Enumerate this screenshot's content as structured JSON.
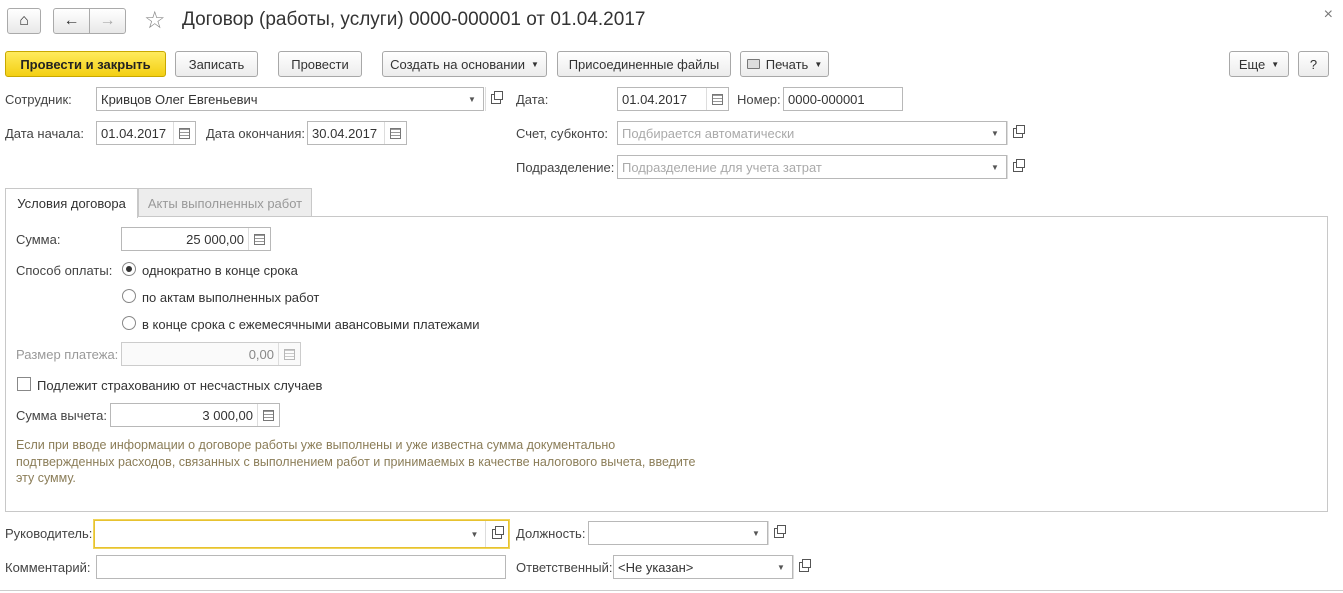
{
  "window": {
    "title": "Договор (работы, услуги) 0000-000001 от 01.04.2017",
    "close_glyph": "×"
  },
  "nav": {
    "home_glyph": "⌂",
    "back_glyph": "←",
    "forward_glyph": "→",
    "favorite_glyph": "☆"
  },
  "toolbar": {
    "post_close": "Провести и закрыть",
    "save": "Записать",
    "post": "Провести",
    "create_based": "Создать на основании",
    "attached_files": "Присоединенные файлы",
    "print": "Печать",
    "more": "Еще",
    "help": "?"
  },
  "header": {
    "employee_label": "Сотрудник:",
    "employee_value": "Кривцов Олег Евгеньевич",
    "date_label": "Дата:",
    "date_value": "01.04.2017",
    "number_label": "Номер:",
    "number_value": "0000-000001",
    "start_label": "Дата начала:",
    "start_value": "01.04.2017",
    "end_label": "Дата окончания:",
    "end_value": "30.04.2017",
    "account_label": "Счет, субконто:",
    "account_placeholder": "Подбирается автоматически",
    "division_label": "Подразделение:",
    "division_placeholder": "Подразделение для учета затрат"
  },
  "tabs": [
    {
      "label": "Условия договора",
      "active": true
    },
    {
      "label": "Акты выполненных работ",
      "active": false
    }
  ],
  "conditions": {
    "sum_label": "Сумма:",
    "sum_value": "25 000,00",
    "payment_label": "Способ оплаты:",
    "payment_options": [
      {
        "label": "однократно в конце срока",
        "selected": true
      },
      {
        "label": "по актам выполненных работ",
        "selected": false
      },
      {
        "label": "в конце срока с ежемесячными авансовыми платежами",
        "selected": false
      }
    ],
    "payment_size_label": "Размер платежа:",
    "payment_size_value": "0,00",
    "insurance_label": "Подлежит страхованию от несчастных случаев",
    "insurance_checked": false,
    "deduction_label": "Сумма вычета:",
    "deduction_value": "3 000,00",
    "hint": "Если при вводе информации о договоре работы уже выполнены и уже известна сумма документально подтвержденных расходов, связанных с выполнением работ и принимаемых в качестве налогового вычета, введите эту сумму."
  },
  "footer": {
    "manager_label": "Руководитель:",
    "manager_value": "",
    "position_label": "Должность:",
    "position_value": "",
    "comment_label": "Комментарий:",
    "comment_value": "",
    "responsible_label": "Ответственный:",
    "responsible_value": "<Не указан>"
  },
  "colors": {
    "primary_button": "#f3cf13",
    "hint_text": "#8b7d58",
    "focus_border": "#e7c230"
  }
}
